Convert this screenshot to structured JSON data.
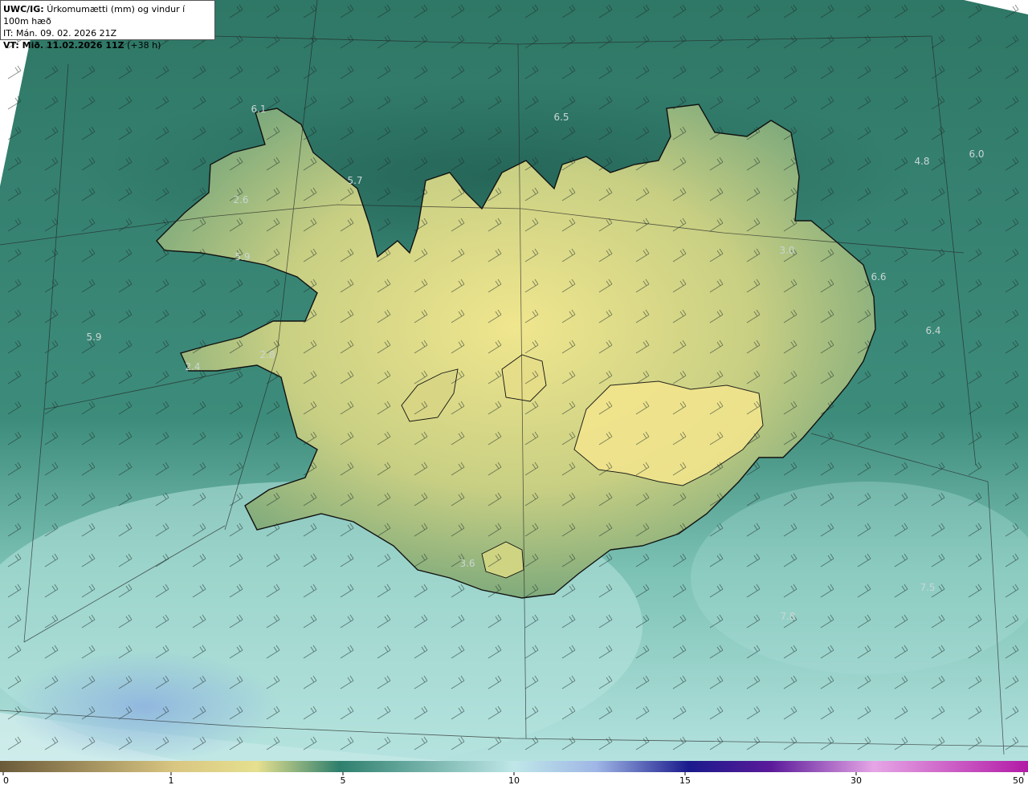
{
  "header": {
    "model": "UWC/IG:",
    "title": "Úrkomumætti (mm) og vindur í 100m hæð",
    "it_line": "IT: Mán. 09. 02. 2026 21Z",
    "vt_prefix": "VT: Mið. 11.02.2026 11Z",
    "vt_suffix": " (+38 h)"
  },
  "colors": {
    "sea_dark": "#2c7061",
    "sea_mid": "#3e8c7c",
    "land_yellow": "#e2dd8a",
    "land_green": "#8fb07a",
    "south_light": "#a8dbd6",
    "south_blue": "#8fb4e0",
    "coast": "#111111",
    "wind_barb": "#1c2a26"
  },
  "map_labels": [
    {
      "text": "6.1"
    },
    {
      "text": "6.5"
    },
    {
      "text": "5.7"
    },
    {
      "text": "4.8"
    },
    {
      "text": "6.0"
    },
    {
      "text": "2.6"
    },
    {
      "text": "3.0"
    },
    {
      "text": "5.9"
    },
    {
      "text": "6.6"
    },
    {
      "text": "5.9"
    },
    {
      "text": "6.4"
    },
    {
      "text": "2.8"
    },
    {
      "text": "2.4"
    },
    {
      "text": "3.6"
    },
    {
      "text": "7.5"
    },
    {
      "text": "7.8"
    }
  ],
  "colorbar": {
    "ticks": [
      "0",
      "1",
      "5",
      "10",
      "15",
      "30",
      "50"
    ],
    "stops": [
      "#6b5a3a",
      "#d9c682",
      "#e6e08f",
      "#2e7f6d",
      "#bfe7e8",
      "#9fb6e6",
      "#1a1a8c",
      "#5b1a9a",
      "#e6a6e6",
      "#b21aa6"
    ]
  }
}
